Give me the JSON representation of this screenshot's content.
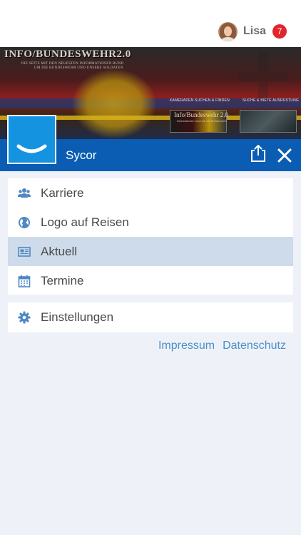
{
  "header": {
    "user_name": "Lisa",
    "notification_count": "7"
  },
  "banner": {
    "title": "INFO/BUNDESWEHR2.0",
    "subtitle_line1": "DIE SEITE MIT DEN NEUESTEN INFORMATIONEN RUND",
    "subtitle_line2": "UM DIE BUNDESWEHR UND UNSERE SOLDATEN.",
    "link_left": "KAMERADEN SUCHEN & FINDEN",
    "link_right": "SUCHE & BIETE AUSRÜSTUNG",
    "thumb_title": "Info/Bundeswehr 2.0",
    "thumb_subtitle": "Informationen rund um die Bundeswehr"
  },
  "app": {
    "title": "Sycor"
  },
  "menu": {
    "items": [
      {
        "label": "Karriere",
        "icon": "users-icon"
      },
      {
        "label": "Logo auf Reisen",
        "icon": "globe-icon"
      },
      {
        "label": "Aktuell",
        "icon": "newspaper-icon",
        "active": true
      },
      {
        "label": "Termine",
        "icon": "calendar-icon"
      }
    ],
    "settings": {
      "label": "Einstellungen",
      "icon": "gear-icon"
    }
  },
  "footer": {
    "impressum": "Impressum",
    "datenschutz": "Datenschutz"
  },
  "colors": {
    "accent": "#0a5db2",
    "logo_blue": "#1493e0",
    "badge_red": "#e0262c",
    "active_row": "#cddbea",
    "link": "#4a8ec6",
    "icon": "#4f88c2"
  }
}
